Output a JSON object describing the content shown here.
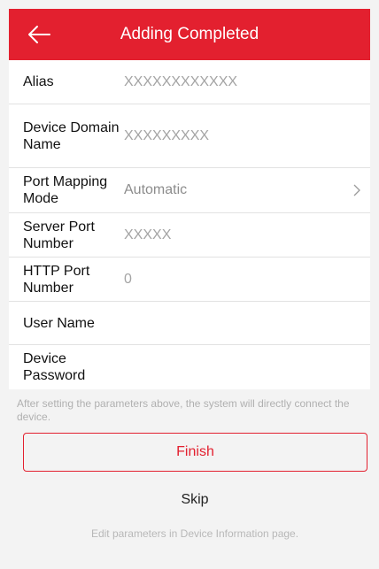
{
  "header": {
    "title": "Adding Completed",
    "back_icon": "arrow-left-icon",
    "accent_color": "#e3202f"
  },
  "form": {
    "alias": {
      "label": "Alias",
      "placeholder": "XXXXXXXXXXXX"
    },
    "domain": {
      "label": "Device Domain Name",
      "placeholder": "XXXXXXXXX"
    },
    "port_mapping": {
      "label": "Port Mapping Mode",
      "value": "Automatic",
      "icon": "chevron-right-icon"
    },
    "server_port": {
      "label": "Server Port Number",
      "placeholder": "XXXXX"
    },
    "http_port": {
      "label": "HTTP Port Number",
      "value": "0"
    },
    "username": {
      "label": "User Name",
      "value": ""
    },
    "password": {
      "label": "Device Password",
      "value": ""
    }
  },
  "note": "After setting the parameters above, the system will directly connect the device.",
  "actions": {
    "finish_label": "Finish",
    "skip_label": "Skip",
    "hint": "Edit parameters in Device Information page."
  }
}
